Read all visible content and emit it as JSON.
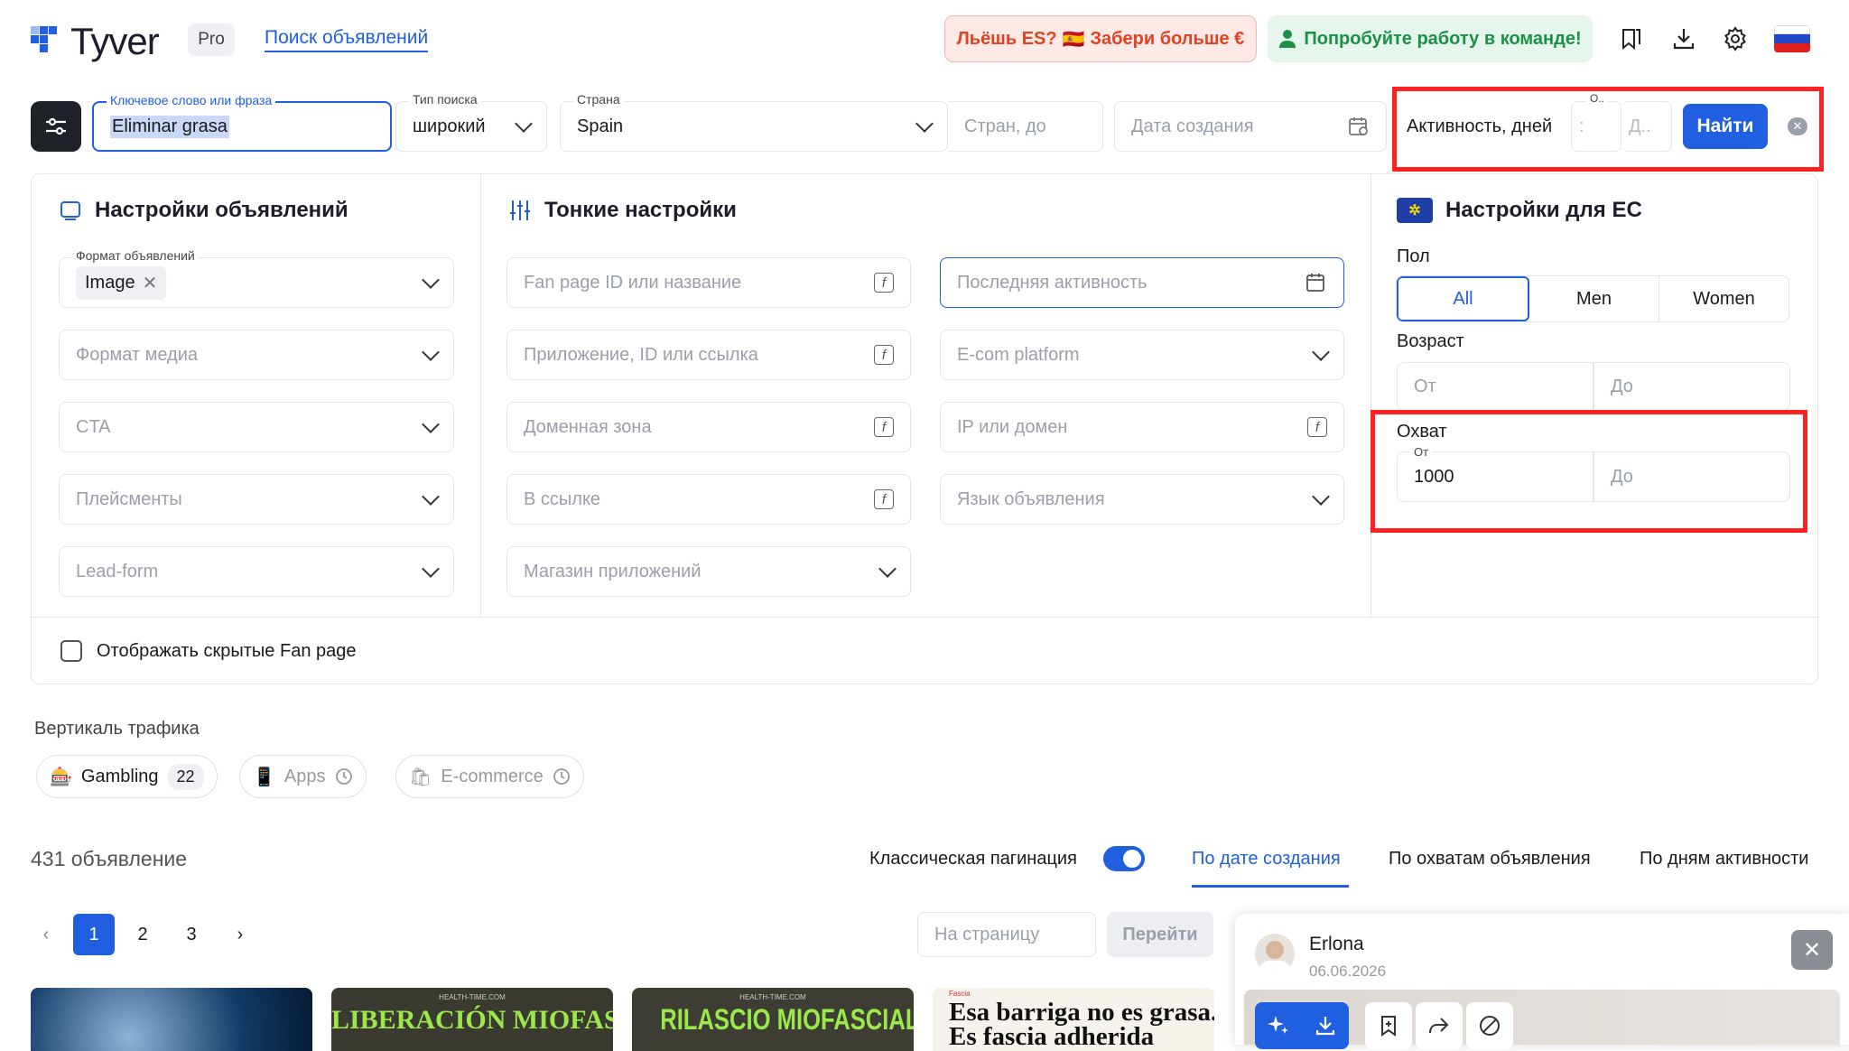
{
  "header": {
    "logo": "Tyver",
    "plan": "Pro",
    "nav_link": "Поиск объявлений",
    "promo_es": "Льёшь ES?",
    "promo_es_flag": "🇪🇸",
    "promo_es_cta": "Забери больше €",
    "promo_team": "Попробуйте работу в команде!"
  },
  "search": {
    "keyword_label": "Ключевое слово или фраза",
    "keyword_value": "Eliminar grasa",
    "type_label": "Тип поиска",
    "type_value": "широкий",
    "country_label": "Страна",
    "country_value": "Spain",
    "country_to_placeholder": "Стран, до",
    "date_placeholder": "Дата создания",
    "activity_label": "Активность, дней",
    "activity_from_label": "О..",
    "activity_from_value": ":",
    "activity_to_placeholder": "Д..",
    "find_button": "Найти"
  },
  "ads_settings": {
    "title": "Настройки объявлений",
    "format_label": "Формат объявлений",
    "format_tag": "Image",
    "media_format": "Формат медиа",
    "cta": "CTA",
    "placements": "Плейсменты",
    "lead_form": "Lead-form"
  },
  "fine_settings": {
    "title": "Тонкие настройки",
    "fan_page": "Fan page ID или название",
    "app": "Приложение, ID или ссылка",
    "domain_zone": "Доменная зона",
    "in_link": "В ссылке",
    "app_store": "Магазин приложений",
    "last_activity": "Последняя активность",
    "ecom": "E-com platform",
    "ip_domain": "IP или домен",
    "ad_language": "Язык объявления"
  },
  "eu_settings": {
    "title": "Настройки для ЕС",
    "gender_label": "Пол",
    "genders": [
      "All",
      "Men",
      "Women"
    ],
    "age_label": "Возраст",
    "from_placeholder": "От",
    "to_placeholder": "До",
    "reach_label": "Охват",
    "reach_from_label": "От",
    "reach_from_value": "1000",
    "reach_to_placeholder": "До"
  },
  "hidden_fanpage": "Отображать скрытые Fan page",
  "vertical": {
    "label": "Вертикаль трафика",
    "chips": [
      {
        "label": "Gambling",
        "count": "22"
      },
      {
        "label": "Apps"
      },
      {
        "label": "E-commerce"
      }
    ]
  },
  "results": {
    "count": "431 объявление",
    "pagination_label": "Классическая пагинация",
    "tabs": [
      "По дате создания",
      "По охватам объявления",
      "По дням активности"
    ],
    "pages": [
      "1",
      "2",
      "3"
    ],
    "goto_placeholder": "На страницу",
    "goto_button": "Перейти"
  },
  "cards": [
    {
      "headline": ""
    },
    {
      "source": "HEALTH-TIME.COM",
      "headline": "LIBERACIÓN MIOFASCIAL"
    },
    {
      "source": "HEALTH-TIME.COM",
      "headline": "RILASCIO MIOFASCIALE"
    },
    {
      "tag": "Fascia",
      "headline": "Esa barriga no es grasa.",
      "subline": "Es fascia adherida"
    }
  ],
  "popup": {
    "name": "Erlona",
    "date": "06.06.2026"
  },
  "colors": {
    "accent": "#1f5fe0",
    "highlight": "#ff2222"
  }
}
